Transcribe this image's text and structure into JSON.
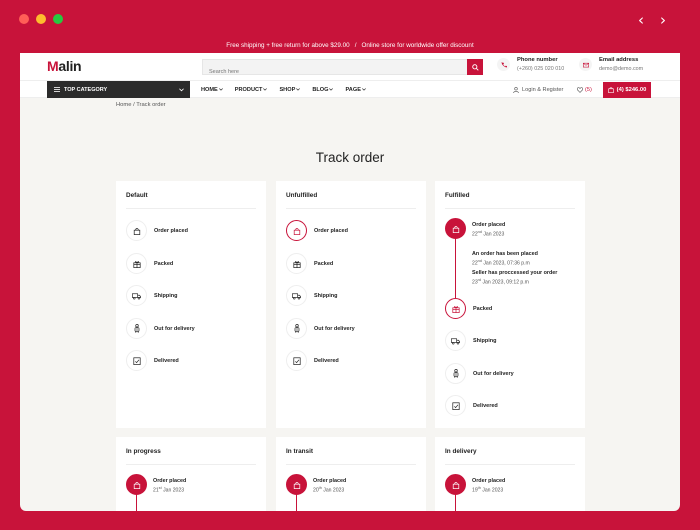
{
  "window": {
    "promo": "Free shipping + free return for above $29.00",
    "promo_sep": "/",
    "promo2": "Online store for worldwide offer discount"
  },
  "header": {
    "logo_m": "M",
    "logo_rest": "alin",
    "search_placeholder": "Search here",
    "phone_label": "Phone number",
    "phone_value": "(+260) 025 020 010",
    "email_label": "Email address",
    "email_value": "demo@demo.com"
  },
  "nav": {
    "top_category": "TOP CATEGORY",
    "menu": [
      "HOME",
      "PRODUCT",
      "SHOP",
      "BLOG",
      "PAGE"
    ],
    "login": "Login & Register",
    "wishlist": "(5)",
    "cart": "(4) $246.00"
  },
  "breadcrumb": "Home / Track order",
  "page_title": "Track order",
  "cards": {
    "default": {
      "title": "Default",
      "steps": [
        "Order placed",
        "Packed",
        "Shipping",
        "Out for delivery",
        "Delivered"
      ]
    },
    "unfulfilled": {
      "title": "Unfulfilled",
      "steps": [
        "Order placed",
        "Packed",
        "Shipping",
        "Out for delivery",
        "Delivered"
      ]
    },
    "fulfilled": {
      "title": "Fulfilled",
      "steps": [
        "Order placed",
        "Packed",
        "Shipping",
        "Out for delivery",
        "Delivered"
      ],
      "placed_day": "22",
      "placed_sup": "nd",
      "placed_rest": "Jan 2023",
      "event1": "An order has been placed",
      "event1_day": "22",
      "event1_sup": "nd",
      "event1_rest": "Jan 2023, 07:36 p.m",
      "event2": "Seller has proccessed your order",
      "event2_day": "23",
      "event2_sup": "rd",
      "event2_rest": "Jan 2023, 09:12 p.m"
    },
    "in_progress": {
      "title": "In progress",
      "step": "Order placed",
      "day": "21",
      "sup": "st",
      "rest": "Jan 2023"
    },
    "in_transit": {
      "title": "In transit",
      "step": "Order placed",
      "day": "20",
      "sup": "th",
      "rest": "Jan 2023"
    },
    "in_delivery": {
      "title": "In delivery",
      "step": "Order placed",
      "day": "19",
      "sup": "th",
      "rest": "Jan 2023"
    }
  },
  "colors": {
    "accent": "#c8133a",
    "dark": "#2b2b2b",
    "bg": "#f6f5f2"
  }
}
